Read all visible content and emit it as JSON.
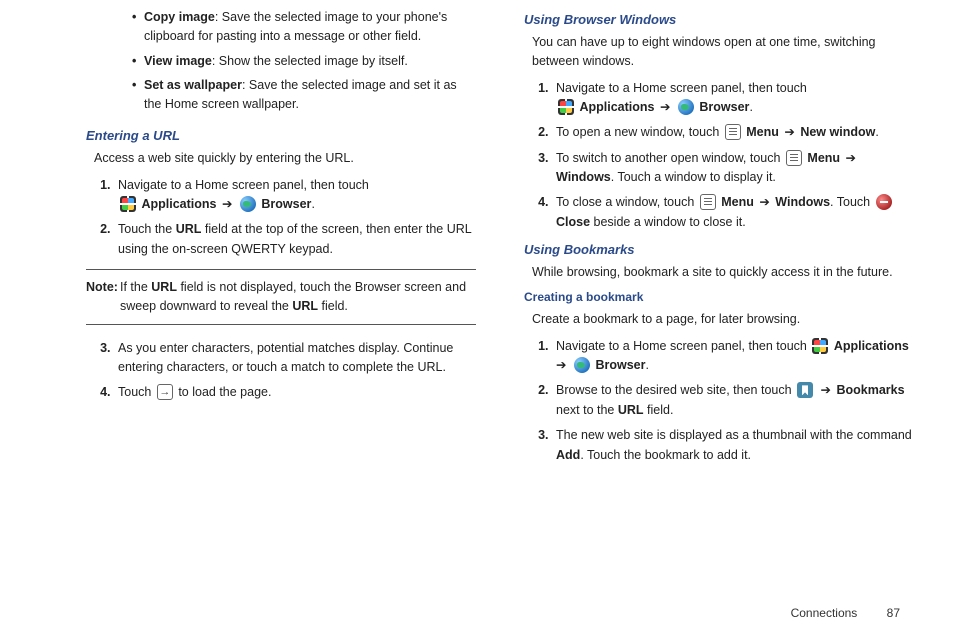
{
  "col1": {
    "bullets": [
      {
        "term": "Copy image",
        "desc": ": Save the selected image to your phone's clipboard for pasting into a message or other field."
      },
      {
        "term": "View image",
        "desc": ": Show the selected image by itself."
      },
      {
        "term": "Set as wallpaper",
        "desc": ": Save the selected image and set it as the Home screen wallpaper."
      }
    ],
    "heading1": "Entering a URL",
    "intro1": "Access a web site quickly by entering the URL.",
    "steps_a": {
      "s1a": "Navigate to a Home screen panel, then touch ",
      "apps": "Applications",
      "arrow": " ➔ ",
      "browser": "Browser",
      "s1b": ".",
      "s2a": "Touch the ",
      "url": "URL",
      "s2b": " field at the top of the screen, then enter the URL using the on-screen QWERTY keypad."
    },
    "note": {
      "label": "Note:",
      "n1": "If the ",
      "url": "URL",
      "n2": " field is not displayed, touch the Browser screen and sweep downward to reveal the ",
      "n3": " field."
    },
    "steps_b": {
      "s3": "As you enter characters, potential matches display. Continue entering characters, or touch a match to complete the URL.",
      "s4a": "Touch ",
      "s4b": " to load the page."
    }
  },
  "col2": {
    "heading1": "Using Browser Windows",
    "intro1": "You can have up to eight windows open at one time, switching between windows.",
    "steps_a": {
      "s1a": "Navigate to a Home screen panel, then touch ",
      "apps": "Applications",
      "arrow": " ➔ ",
      "browser": "Browser",
      "s1b": ".",
      "s2a": "To open a new window, touch ",
      "menu": "Menu",
      "newwin": "New window",
      "s2c": ".",
      "s3a": "To switch to another open window, touch ",
      "windows": "Windows",
      "s3b": ". Touch a window to display it.",
      "s4a": "To close a window, touch ",
      "s4b": ". Touch ",
      "close": "Close",
      "s4c": " beside a window to close it."
    },
    "heading2": "Using Bookmarks",
    "intro2": "While browsing, bookmark a site to quickly access it in the future.",
    "heading3": "Creating a bookmark",
    "intro3": "Create a bookmark to a page, for later browsing.",
    "steps_b": {
      "s1a": "Navigate to a Home screen panel, then touch ",
      "apps": "Applications",
      "arrow": " ➔ ",
      "browser": "Browser",
      "s1b": ".",
      "s2a": "Browse to the desired web site, then touch ",
      "bookmarks": "Bookmarks",
      "s2b": " next to the ",
      "url": "URL",
      "s2c": " field.",
      "s3a": "The new web site is displayed as a thumbnail with the command ",
      "add": "Add",
      "s3b": ". Touch the bookmark to add it."
    }
  },
  "footer": {
    "section": "Connections",
    "page": "87"
  }
}
